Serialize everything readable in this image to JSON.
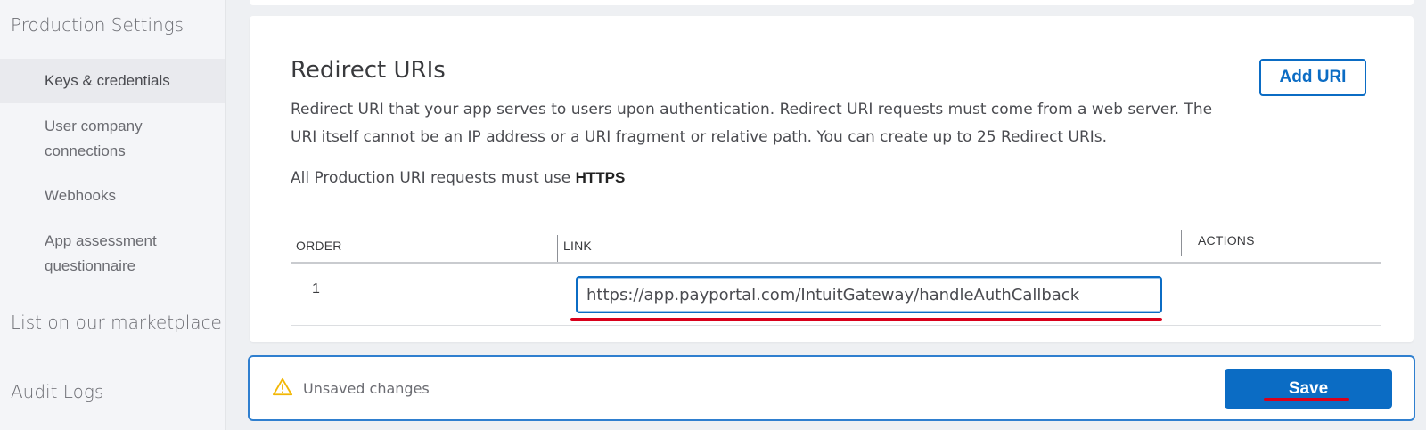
{
  "sidebar": {
    "sections": [
      {
        "label": "Production Settings"
      },
      {
        "label": "List on our marketplace"
      },
      {
        "label": "Audit Logs"
      }
    ],
    "items": [
      {
        "label": "Keys & credentials"
      },
      {
        "label": "User company"
      },
      {
        "label": "connections"
      },
      {
        "label": "Webhooks"
      },
      {
        "label": "App assessment"
      },
      {
        "label": "questionnaire"
      }
    ]
  },
  "main": {
    "title": "Redirect URIs",
    "add_button": "Add URI",
    "description": "Redirect URI that your app serves to users upon authentication. Redirect URI requests must come from a web server. The URI itself cannot be an IP address or a URI fragment or relative path. You can create up to 25 Redirect URIs.",
    "https_prefix": "All Production URI requests must use",
    "https_word": "HTTPS",
    "table": {
      "headers": {
        "order": "ORDER",
        "link": "LINK",
        "actions": "ACTIONS"
      },
      "rows": [
        {
          "order": "1",
          "link": "https://app.payportal.com/IntuitGateway/handleAuthCallback"
        }
      ]
    }
  },
  "footer": {
    "status": "Unsaved changes",
    "save_button": "Save"
  },
  "colors": {
    "accent": "#0b6cc4",
    "annotation_red": "#d9001b",
    "warning": "#f2b705"
  },
  "icons": {
    "warning": "warning-triangle-icon"
  }
}
